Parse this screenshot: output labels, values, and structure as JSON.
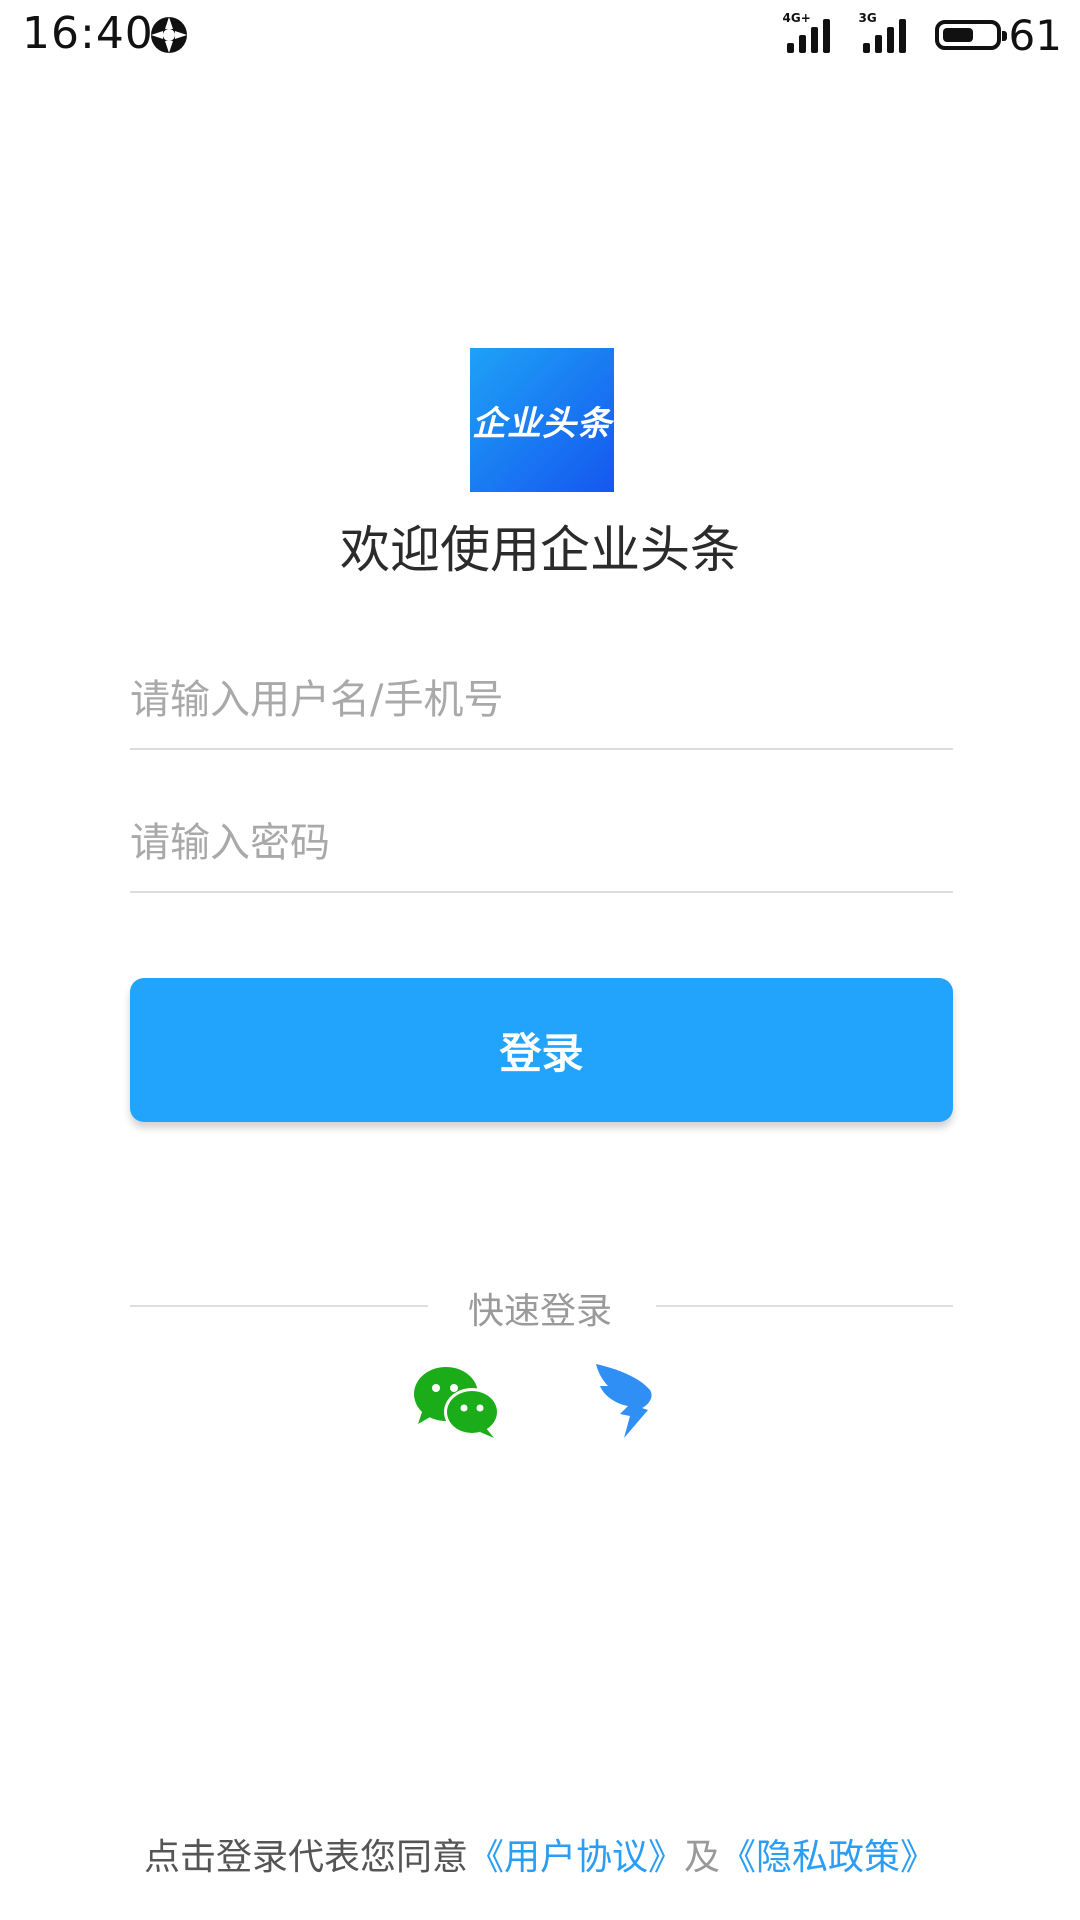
{
  "status_bar": {
    "time": "16:40",
    "signal1_label": "4G+",
    "signal2_label": "3G",
    "battery_level": "61",
    "battery_fraction": 0.61
  },
  "app": {
    "logo_text": "企业头条",
    "welcome": "欢迎使用企业头条",
    "brand_gradient": [
      "#1ea2f7",
      "#1557ee"
    ]
  },
  "login_form": {
    "username_placeholder": "请输入用户名/手机号",
    "username_value": "",
    "password_placeholder": "请输入密码",
    "password_value": "",
    "login_label": "登录",
    "login_color": "#22a4fc"
  },
  "quick_login": {
    "label": "快速登录",
    "options": [
      {
        "icon": "wechat-icon",
        "color": "#1aad19"
      },
      {
        "icon": "dingtalk-icon",
        "color": "#2f8ff5"
      }
    ]
  },
  "agreement": {
    "prefix": "点击登录代表您同意",
    "user_agreement": "《用户协议》",
    "conjunction": "及",
    "privacy_policy": "《隐私政策》",
    "link_color": "#2a9df5"
  }
}
